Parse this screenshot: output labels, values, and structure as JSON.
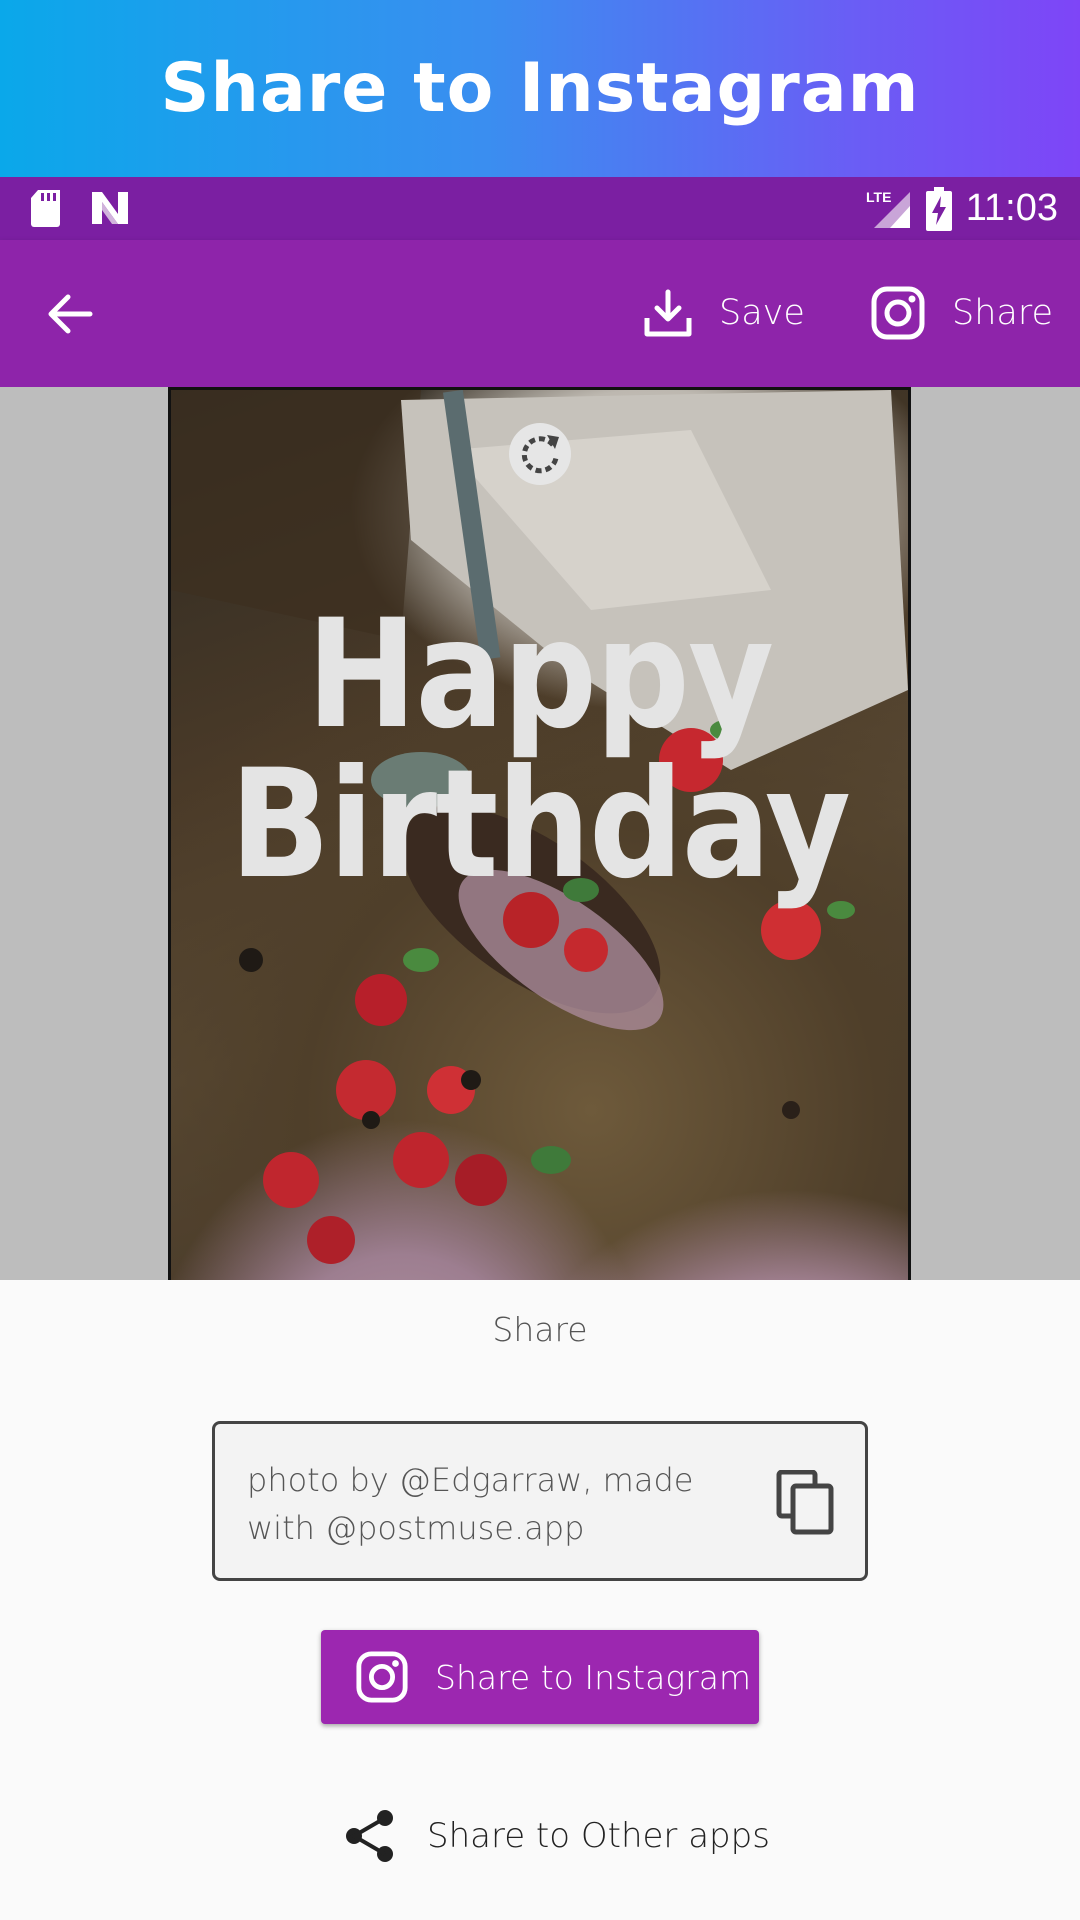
{
  "banner": {
    "title": "Share to Instagram"
  },
  "statusbar": {
    "left_icons": [
      "sd-card-icon",
      "n-app-icon"
    ],
    "right_icons": [
      "lte-signal-icon",
      "battery-charging-icon"
    ],
    "network_label": "LTE",
    "time": "11:03"
  },
  "toolbar": {
    "back_icon": "arrow-left-icon",
    "save_label": "Save",
    "save_icon": "download-icon",
    "share_label": "Share",
    "share_icon": "instagram-icon"
  },
  "preview": {
    "rotate_icon": "rotate-icon",
    "line1": "Happy",
    "line2": "Birthday"
  },
  "sheet": {
    "title": "Share",
    "caption": "photo by @Edgarraw, made with @postmuse.app",
    "copy_icon": "copy-icon",
    "instagram_button_label": "Share to Instagram",
    "other_apps_label": "Share to Other apps",
    "other_apps_icon": "share-icon"
  },
  "colors": {
    "statusbar": "#7b1fa2",
    "toolbar": "#8e24aa",
    "primary_button": "#9c27b0",
    "banner_start": "#0aa8ea",
    "banner_end": "#7e45f7"
  }
}
